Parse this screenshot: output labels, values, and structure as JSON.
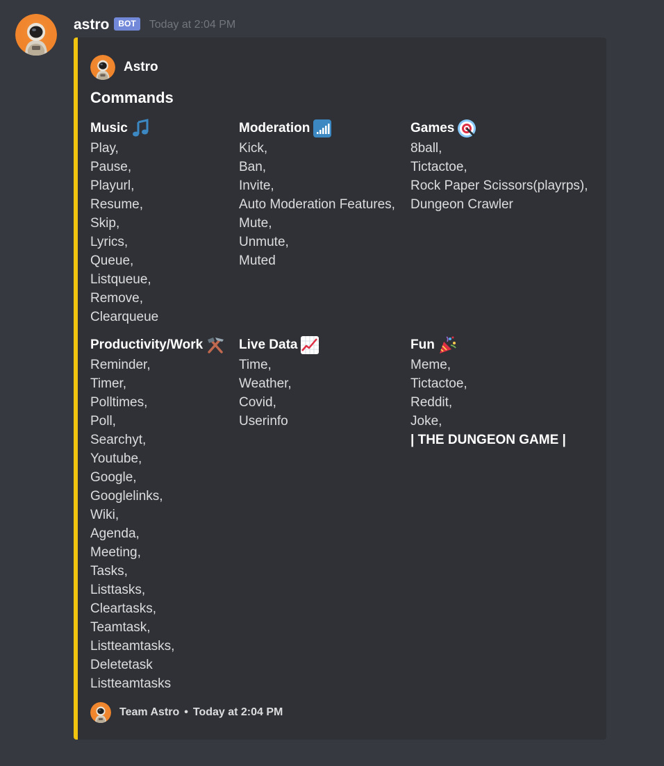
{
  "message": {
    "username": "astro",
    "badge": "BOT",
    "timestamp": "Today at 2:04 PM",
    "avatar_icon": "astronaut-avatar-icon"
  },
  "embed": {
    "accent_color": "#f1c40f",
    "author": {
      "name": "Astro",
      "icon": "astronaut-avatar-icon"
    },
    "title": "Commands",
    "fields": [
      {
        "name": "Music",
        "emoji": "musical-note-icon",
        "items": [
          "Play,",
          "Pause,",
          "Playurl,",
          "Resume,",
          "Skip,",
          "Lyrics,",
          "Queue,",
          "Listqueue,",
          "Remove,",
          "Clearqueue"
        ]
      },
      {
        "name": "Moderation",
        "emoji": "signal-bars-icon",
        "items": [
          "Kick,",
          "Ban,",
          "Invite,",
          "Auto Moderation Features,",
          "Mute,",
          "Unmute,",
          "Muted"
        ]
      },
      {
        "name": "Games",
        "emoji": "target-icon",
        "items": [
          "8ball,",
          "Tictactoe,",
          "Rock Paper Scissors(playrps),",
          "Dungeon Crawler"
        ]
      },
      {
        "name": "Productivity/Work",
        "emoji": "hammer-and-pick-icon",
        "items": [
          "Reminder,",
          "Timer,",
          "Polltimes,",
          "Poll,",
          "Searchyt,",
          "Youtube,",
          "Google,",
          "Googlelinks,",
          "Wiki,",
          "Agenda,",
          "Meeting,",
          "Tasks,",
          "Listtasks,",
          "Cleartasks,",
          "Teamtask,",
          "Listteamtasks,",
          "Deletetask",
          "Listteamtasks"
        ]
      },
      {
        "name": "Live Data",
        "emoji": "chart-increasing-icon",
        "items": [
          "Time,",
          "Weather,",
          "Covid,",
          "Userinfo"
        ]
      },
      {
        "name": "Fun",
        "emoji": "party-popper-icon",
        "items": [
          "Meme,",
          "Tictactoe,",
          "Reddit,",
          "Joke,"
        ],
        "bold_item": "| THE DUNGEON GAME |"
      }
    ],
    "footer": {
      "text": "Team Astro",
      "separator": "•",
      "timestamp": "Today at 2:04 PM",
      "icon": "astronaut-avatar-icon"
    }
  }
}
